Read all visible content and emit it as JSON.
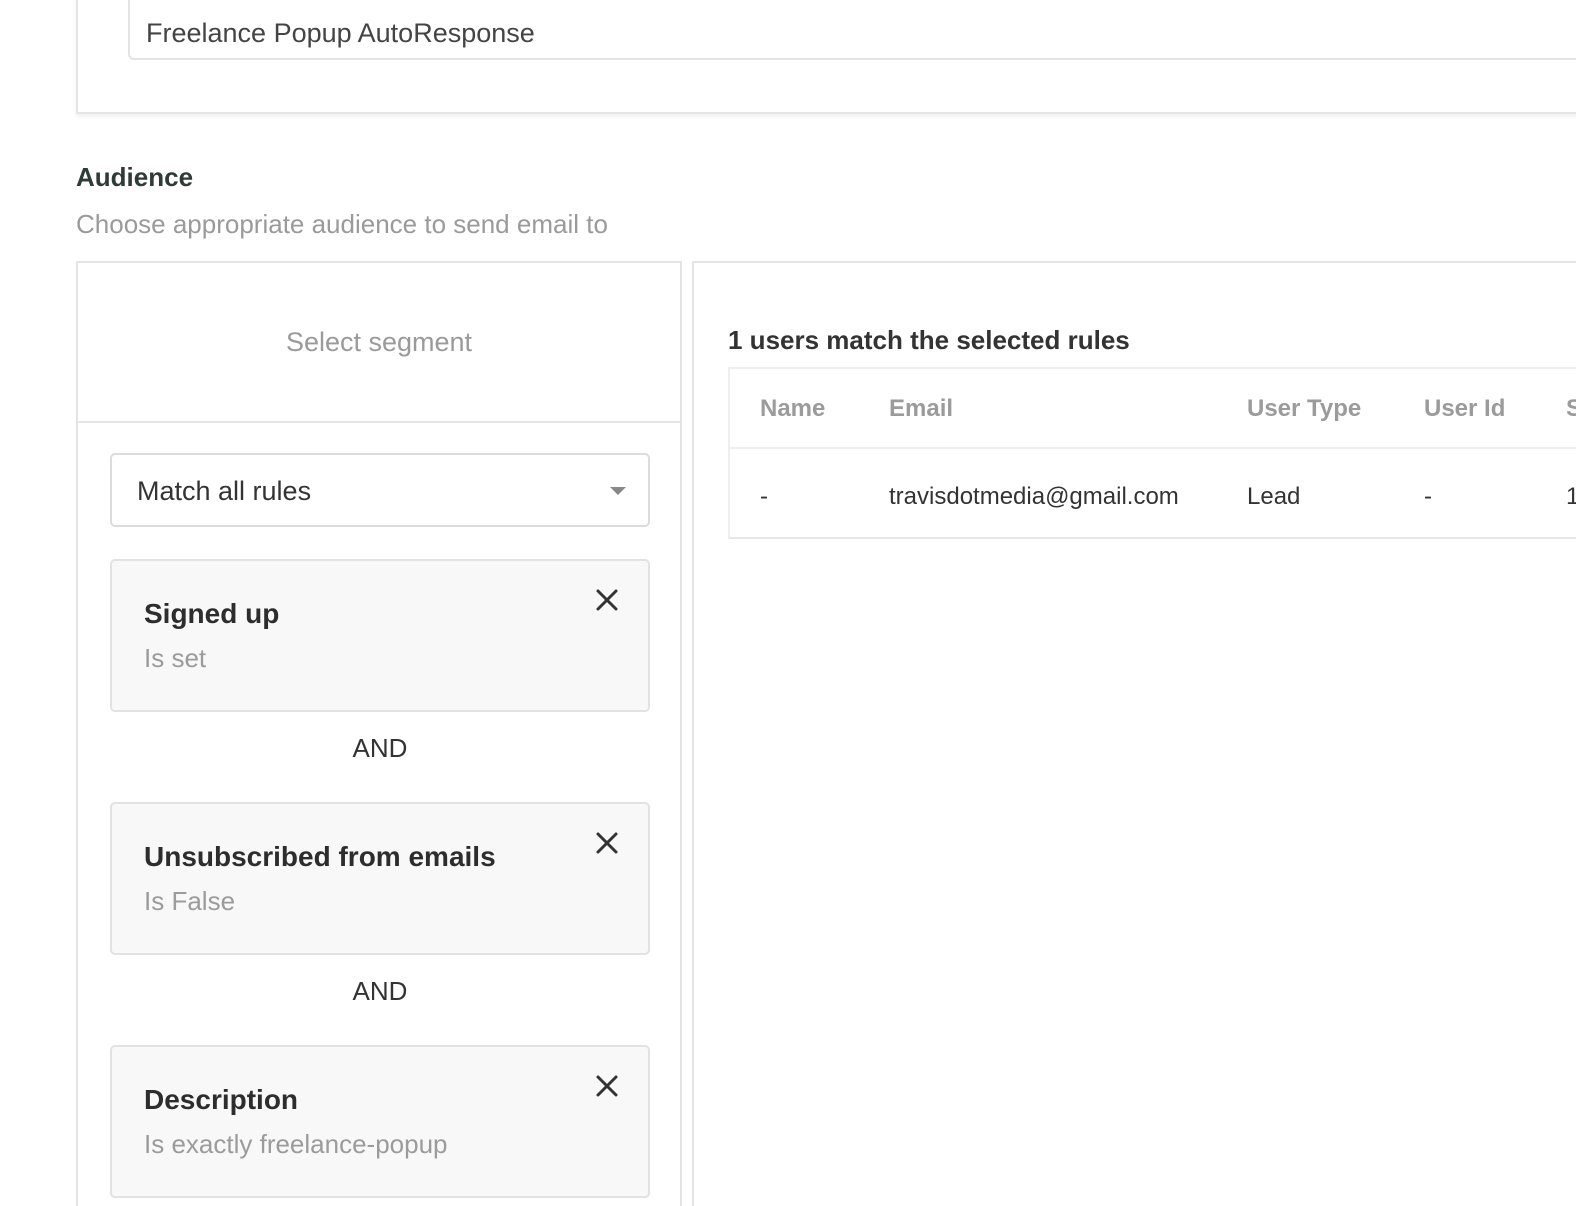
{
  "campaign": {
    "name_value": "Freelance Popup AutoResponse"
  },
  "audience": {
    "title": "Audience",
    "subtitle": "Choose appropriate audience to send email to",
    "segment_placeholder": "Select segment",
    "match_mode": "Match all rules",
    "connector": "AND",
    "rules": [
      {
        "title": "Signed up",
        "condition": "Is set"
      },
      {
        "title": "Unsubscribed from emails",
        "condition": "Is False"
      },
      {
        "title": "Description",
        "condition": "Is exactly freelance-popup"
      }
    ]
  },
  "results": {
    "summary": "1 users match the selected rules",
    "columns": [
      "Name",
      "Email",
      "User Type",
      "User Id",
      "S"
    ],
    "rows": [
      {
        "name": "-",
        "email": "travisdotmedia@gmail.com",
        "user_type": "Lead",
        "user_id": "-",
        "more": "1"
      }
    ]
  },
  "icons": {
    "remove_rule": "close-icon",
    "dropdown": "caret-down-icon"
  },
  "colors": {
    "muted_text": "#9b9b9b",
    "heading_text": "#2f3b36",
    "rule_card_bg": "#f8f8f8",
    "border": "#e4e4e4"
  }
}
